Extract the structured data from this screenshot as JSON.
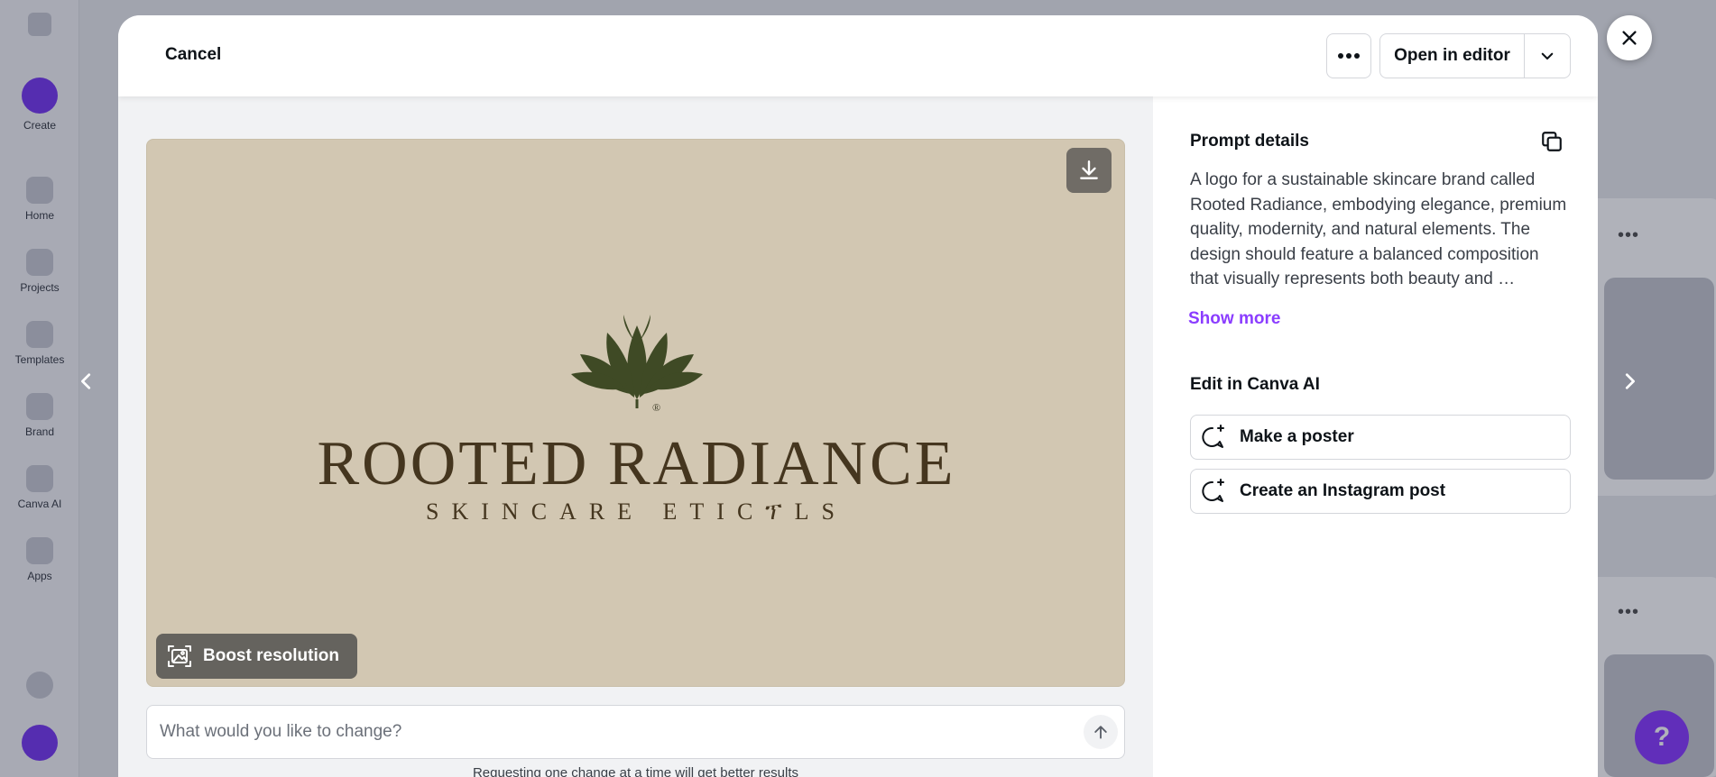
{
  "header": {
    "cancel_label": "Cancel",
    "more_options_icon": "ellipsis-icon",
    "open_in_editor_label": "Open in editor",
    "dropdown_icon": "chevron-down-icon",
    "close_icon": "close-icon"
  },
  "preview": {
    "logo": {
      "icon": "leaf-sprout-logo",
      "registered_mark": "®",
      "brand_name": "ROOTED RADIANCE",
      "tagline": "SKINCARE ETICፕLS"
    },
    "download_icon": "download-icon",
    "boost_icon": "image-enhance-icon",
    "boost_label": "Boost resolution",
    "prev_icon": "chevron-left-icon",
    "next_icon": "chevron-right-icon"
  },
  "change_input": {
    "placeholder": "What would you like to change?",
    "value": "",
    "send_icon": "arrow-up-icon"
  },
  "hint": "Requesting one change at a time will get better results",
  "details": {
    "prompt_title": "Prompt details",
    "copy_icon": "copy-icon",
    "prompt_text": "A logo for a sustainable skincare brand called Rooted Radiance, embodying elegance, premium quality, modernity, and natural elements. The design should feature a balanced composition that visually represents both beauty and …",
    "show_more_label": "Show more",
    "edit_title": "Edit in Canva AI",
    "actions": [
      {
        "label": "Make a poster",
        "icon": "sparkle-chat-icon"
      },
      {
        "label": "Create an Instagram post",
        "icon": "sparkle-chat-icon"
      }
    ]
  },
  "colors": {
    "accent": "#8b3dff",
    "image_background": "#d2c7b2",
    "logo_text": "#45361f",
    "logo_leaf": "#3f4a25"
  }
}
